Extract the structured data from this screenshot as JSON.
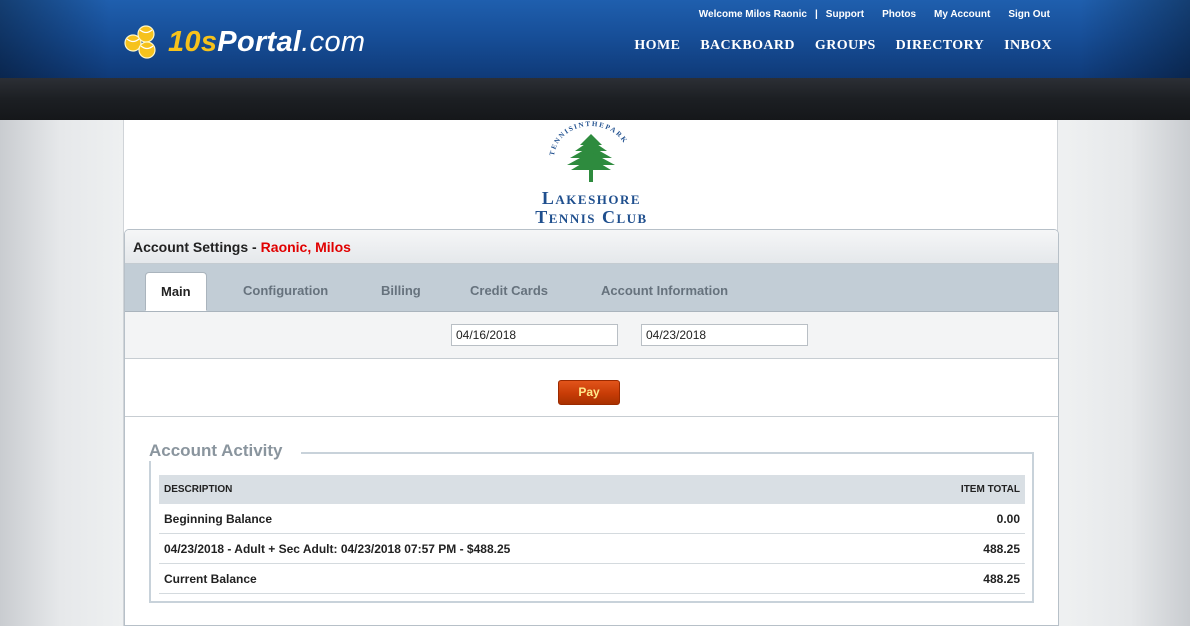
{
  "header": {
    "logo": {
      "ten": "10s",
      "portal": "Portal",
      "com": ".com"
    },
    "top_links": {
      "welcome": "Welcome Milos Raonic",
      "separator": "|",
      "support": "Support",
      "photos": "Photos",
      "my_account": "My Account",
      "sign_out": "Sign Out"
    },
    "nav": [
      "HOME",
      "BACKBOARD",
      "GROUPS",
      "DIRECTORY",
      "INBOX"
    ]
  },
  "club": {
    "arc_text": "TENNISINTHEPARK",
    "name_line1": "Lakeshore",
    "name_line2": "Tennis Club"
  },
  "panel": {
    "title": "Account Settings -",
    "user": "Raonic, Milos"
  },
  "tabs": [
    {
      "label": "Main",
      "active": true
    },
    {
      "label": "Configuration",
      "active": false
    },
    {
      "label": "Billing",
      "active": false
    },
    {
      "label": "Credit Cards",
      "active": false
    },
    {
      "label": "Account Information",
      "active": false
    }
  ],
  "filters": {
    "start_date": "04/16/2018",
    "end_date": "04/23/2018"
  },
  "pay_label": "Pay",
  "activity": {
    "legend": "Account Activity",
    "columns": {
      "description": "DESCRIPTION",
      "item_total": "ITEM TOTAL"
    },
    "rows": [
      {
        "description": "Beginning Balance",
        "total": "0.00"
      },
      {
        "description": "04/23/2018 - Adult + Sec Adult: 04/23/2018 07:57 PM - $488.25",
        "total": "488.25"
      },
      {
        "description": "Current Balance",
        "total": "488.25"
      }
    ]
  },
  "colors": {
    "header_blue": "#174f99",
    "logo_yellow": "#f6c21c",
    "user_name_red": "#e00000",
    "pay_button": "#c73c07",
    "club_green": "#2e8b3e",
    "club_blue": "#1f4f8e"
  }
}
